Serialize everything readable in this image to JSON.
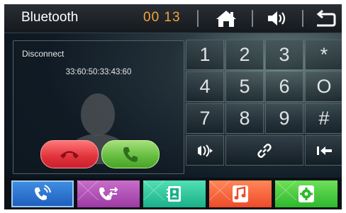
{
  "header": {
    "title": "Bluetooth",
    "time": "00 13",
    "icons": [
      "home-icon",
      "volume-icon",
      "back-icon"
    ]
  },
  "contact": {
    "status": "Disconnect",
    "device_address": "33:60:50:33:43:60",
    "hangup_icon": "hang-up-icon",
    "answer_icon": "answer-call-icon"
  },
  "keypad": {
    "keys": [
      "1",
      "2",
      "3",
      "*",
      "4",
      "5",
      "6",
      "O",
      "7",
      "8",
      "9",
      "#"
    ],
    "bottom_icons": [
      "switch-audio-icon",
      "link-icon",
      "backspace-icon"
    ]
  },
  "bottom_tabs": [
    {
      "name": "dial",
      "icon": "phone-signal-icon",
      "color": "#2a70d0",
      "selected": true
    },
    {
      "name": "call-log",
      "icon": "call-transfer-icon",
      "color": "#b050b8",
      "selected": false
    },
    {
      "name": "contacts",
      "icon": "contacts-book-icon",
      "color": "#2ec89c",
      "selected": false
    },
    {
      "name": "music",
      "icon": "music-note-icon",
      "color": "#f0603a",
      "selected": false
    },
    {
      "name": "settings",
      "icon": "gear-icon",
      "color": "#46c840",
      "selected": false
    }
  ],
  "colors": {
    "accent_time": "#f3a33a",
    "hangup": "#e0323a",
    "answer": "#62bc3e"
  }
}
